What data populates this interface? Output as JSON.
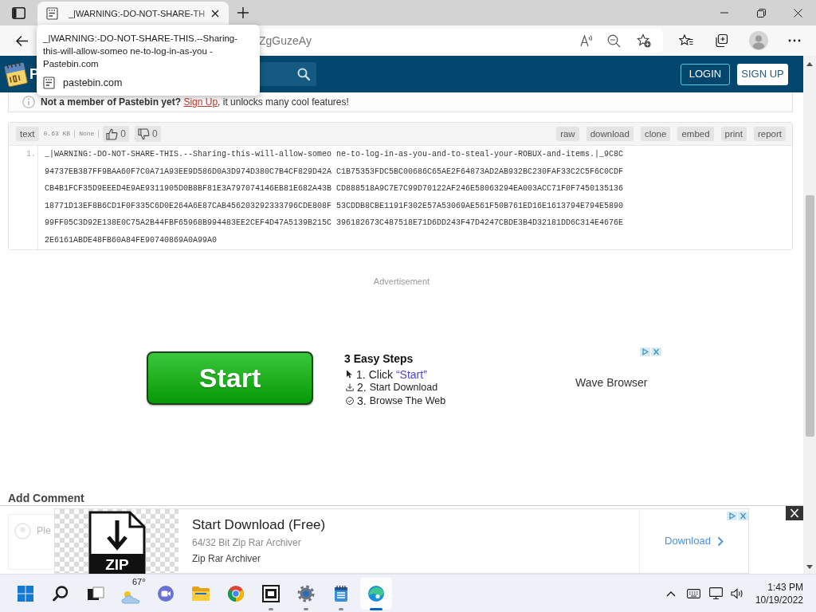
{
  "browser": {
    "tab": {
      "title": "_|WARNING:-DO-NOT-SHARE-TH",
      "selected": true
    },
    "address_bar": {
      "value": "ZgGuzeAy"
    },
    "tab_tooltip": {
      "title_lines": [
        "_|WARNING:-DO-NOT-SHARE-THIS.--Sharing-",
        "this-will-allow-someo ne-to-log-in-as-you -",
        "Pastebin.com"
      ],
      "domain": "pastebin.com"
    }
  },
  "site_header": {
    "logo_text": "P",
    "buttons": [
      {
        "label": "LOGIN",
        "kind": "outline"
      },
      {
        "label": "SIGN UP",
        "kind": "filled"
      }
    ]
  },
  "notice": {
    "lead": "Not a member of Pastebin yet?",
    "link": "Sign Up",
    "rest": ", it unlocks many cool features!"
  },
  "paste": {
    "syntax": "text",
    "size": "0.63 KB",
    "expiry": "None",
    "likes": "0",
    "dislikes": "0",
    "actions": [
      "raw",
      "download",
      "clone",
      "embed",
      "print",
      "report"
    ],
    "lines": [
      {
        "number": "1.",
        "wrapped_text": [
          "_|WARNING:-DO-NOT-SHARE-THIS.--Sharing-this-will-allow-someo ne-to-log-in-as-you-and-to-steal-your-ROBUX-and-items.|_9C8C",
          "94737EB387FF9BAA60F7C0A71A93EE9D586D0A3D974D380C7B4CF829D42A C1B75353FDC5BC00686C65AE2F64873AD2AB932BC230FAF33C2C5F6C0CDF",
          "CB4B1FCF35D9EEED4E9AE9311905D0B8BF81E3A797074146EB81E682A43B CD888518A9C7E7C99D70122AF246E58063294EA003ACC71F0F7450135136",
          "18771D13EF8B6CD1F0F335C6D0E264A6E87CAB456203292333796CDE808F 53CDDB8CBE1191F302E57A53069AE561F50B761ED16E1613794E794E5890",
          "99FF05C3D92E138E0C75A2B44FBF65968B994483EE2CEF4D47A5139B215C 396182673C487518E71D6DD243F47D4247CBDE3B4D32181DD6C314E4676E",
          "2E6161ABDE48FB60A84FE90740869A0A99A0"
        ]
      }
    ]
  },
  "ad": {
    "label": "Advertisement",
    "button": "Start",
    "steps_title": "3 Easy Steps",
    "steps": [
      {
        "number": "1.",
        "text": "Click",
        "highlight": "“Start”"
      },
      {
        "number": "2.",
        "text": "Start Download"
      },
      {
        "number": "3.",
        "text": "Browse The Web"
      }
    ],
    "advertiser": "Wave Browser"
  },
  "comments": {
    "heading": "Add Comment",
    "placeholder": "Ple"
  },
  "bottom_banner": {
    "image_label": "ZIP",
    "title": "Start Download (Free)",
    "subtitle": "64/32 Bit Zip Rar Archiver",
    "advertiser": "Zip Rar Archiver",
    "button": "Download"
  },
  "taskbar": {
    "apps": [
      {
        "running": false,
        "selected": false
      },
      {
        "running": false,
        "selected": false
      },
      {
        "running": false,
        "selected": false
      },
      {
        "running": false,
        "selected": false,
        "label": "67°"
      },
      {
        "running": false,
        "selected": false
      },
      {
        "running": false,
        "selected": false
      },
      {
        "running": false,
        "selected": false
      },
      {
        "running": true,
        "selected": false
      },
      {
        "running": true,
        "selected": false
      },
      {
        "running": true,
        "selected": false
      },
      {
        "running": true,
        "selected": true
      }
    ],
    "time": "1:43 PM",
    "date": "10/19/2022"
  }
}
